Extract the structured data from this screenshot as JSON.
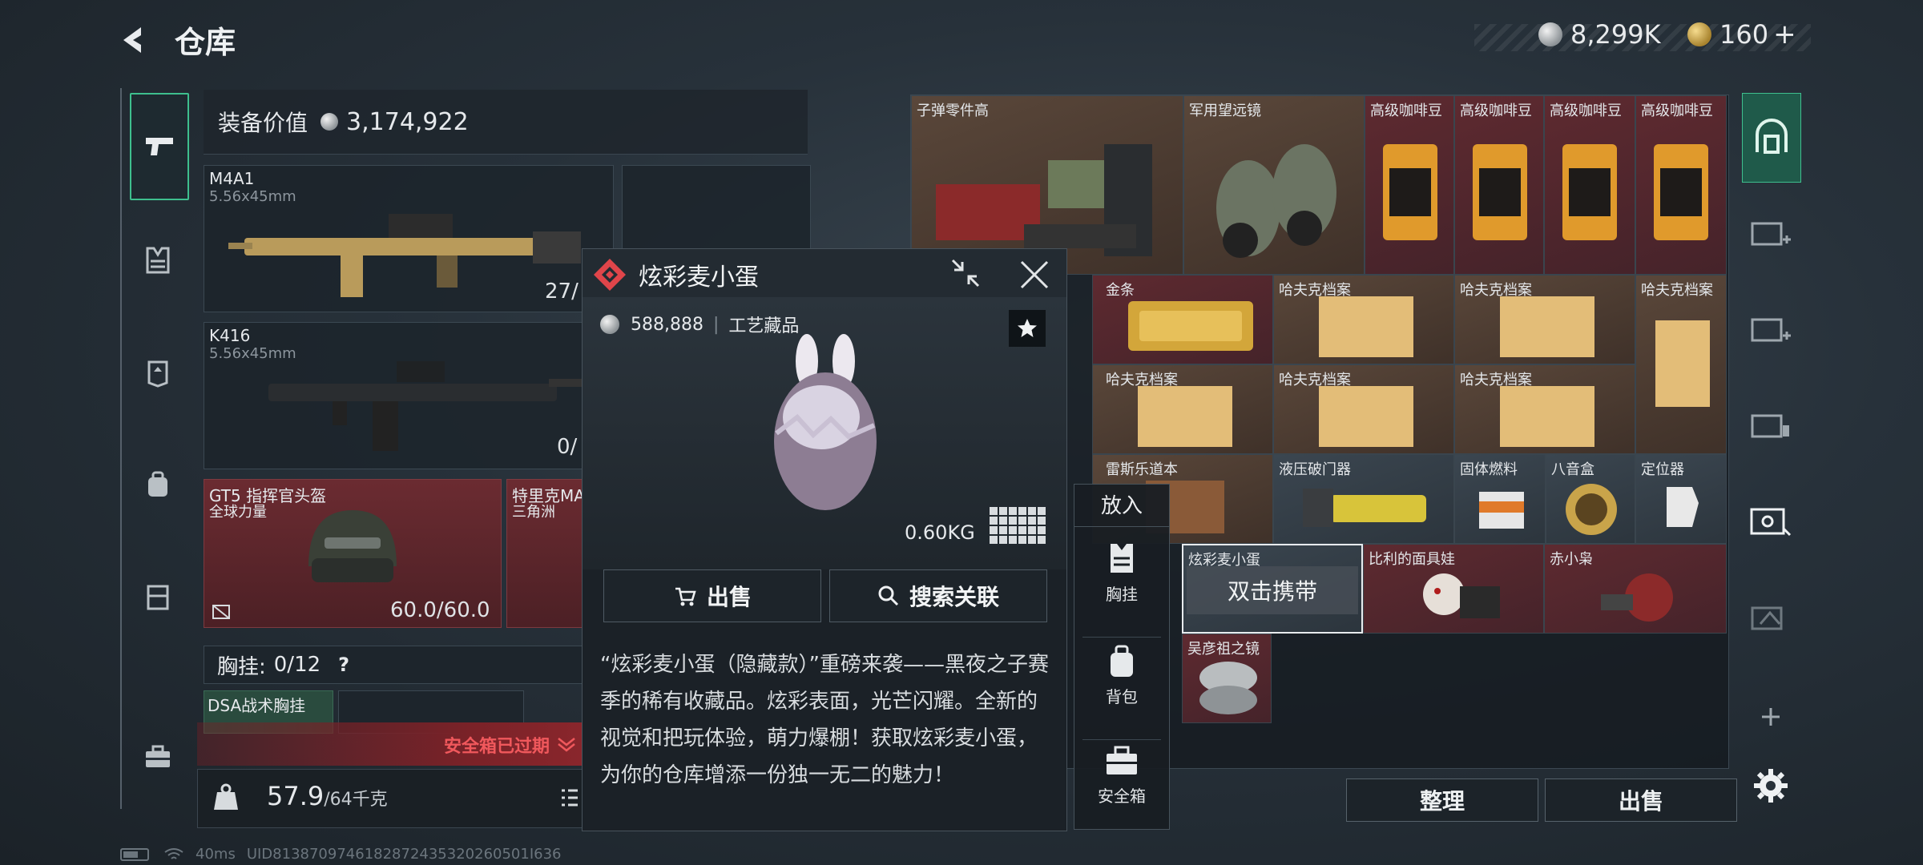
{
  "header": {
    "title": "仓库",
    "currency_silver": "8,299K",
    "currency_gold": "160",
    "plus": "+"
  },
  "loadout": {
    "value_label": "装备价值",
    "value": "3,174,922",
    "weapons": [
      {
        "name": "M4A1",
        "caliber": "5.56x45mm",
        "ammo": "27/"
      },
      {
        "name": "K416",
        "caliber": "5.56x45mm",
        "ammo": "0/"
      }
    ],
    "helmet": {
      "name": "GT5 指挥官头盔",
      "sub": "全球力量",
      "durability": "60.0/60.0"
    },
    "armor": {
      "name": "特里克MA",
      "sub": "三角洲"
    },
    "rig_label": "胸挂:",
    "rig_count": "0/12",
    "help": "?",
    "rig_item": "DSA战术胸挂",
    "safe_expired": "安全箱已过期",
    "weight": "57.9",
    "weight_max": "/64千克"
  },
  "popup": {
    "title": "炫彩麦小蛋",
    "price": "588,888",
    "category": "工艺藏品",
    "weight": "0.60KG",
    "sell": "出售",
    "search": "搜索关联",
    "description": "“炫彩麦小蛋（隐藏款）”重磅来袭——黑夜之子赛季的稀有收藏品。炫彩表面，光芒闪耀。全新的视觉和把玩体验，萌力爆棚！获取炫彩麦小蛋，为你的仓库增添一份独一无二的魅力！"
  },
  "putin": {
    "title": "放入",
    "items": [
      {
        "label": "胸挂"
      },
      {
        "label": "背包"
      },
      {
        "label": "安全箱"
      }
    ]
  },
  "storage": {
    "items": [
      {
        "label": "子弹零件高",
        "bg": "brown"
      },
      {
        "label": "军用望远镜",
        "bg": "brown"
      },
      {
        "label": "高级咖啡豆",
        "bg": "red"
      },
      {
        "label": "高级咖啡豆",
        "bg": "red"
      },
      {
        "label": "高级咖啡豆",
        "bg": "red"
      },
      {
        "label": "高级咖啡豆",
        "bg": "red"
      },
      {
        "label": "金条",
        "bg": "red"
      },
      {
        "label": "哈夫克档案",
        "bg": "brown"
      },
      {
        "label": "哈夫克档案",
        "bg": "brown"
      },
      {
        "label": "哈夫克档案",
        "bg": "brown"
      },
      {
        "label": "哈夫克档案",
        "bg": "brown"
      },
      {
        "label": "哈夫克档案",
        "bg": "brown"
      },
      {
        "label": "哈夫克档案",
        "bg": "brown"
      },
      {
        "label": "雷斯乐道本",
        "bg": "brown"
      },
      {
        "label": "液压破门器",
        "bg": "gray"
      },
      {
        "label": "固体燃料",
        "bg": "gray"
      },
      {
        "label": "八音盒",
        "bg": "gray"
      },
      {
        "label": "定位器",
        "bg": "gray"
      },
      {
        "label": "炫彩麦小蛋",
        "bg": "gray",
        "overlay": "双击携带"
      },
      {
        "label": "比利的面具娃",
        "bg": "red"
      },
      {
        "label": "赤小枭",
        "bg": "red"
      },
      {
        "label": "吴彦祖之镜",
        "bg": "red"
      }
    ],
    "sort": "整理",
    "sell": "出售"
  },
  "status": {
    "ping": "40ms",
    "uid": "UID8138709746182872435320260501I636"
  },
  "colors": {
    "accent_green": "#3ebf8e",
    "danger_red": "#e0454a",
    "slot_red": "#6b2b31"
  }
}
